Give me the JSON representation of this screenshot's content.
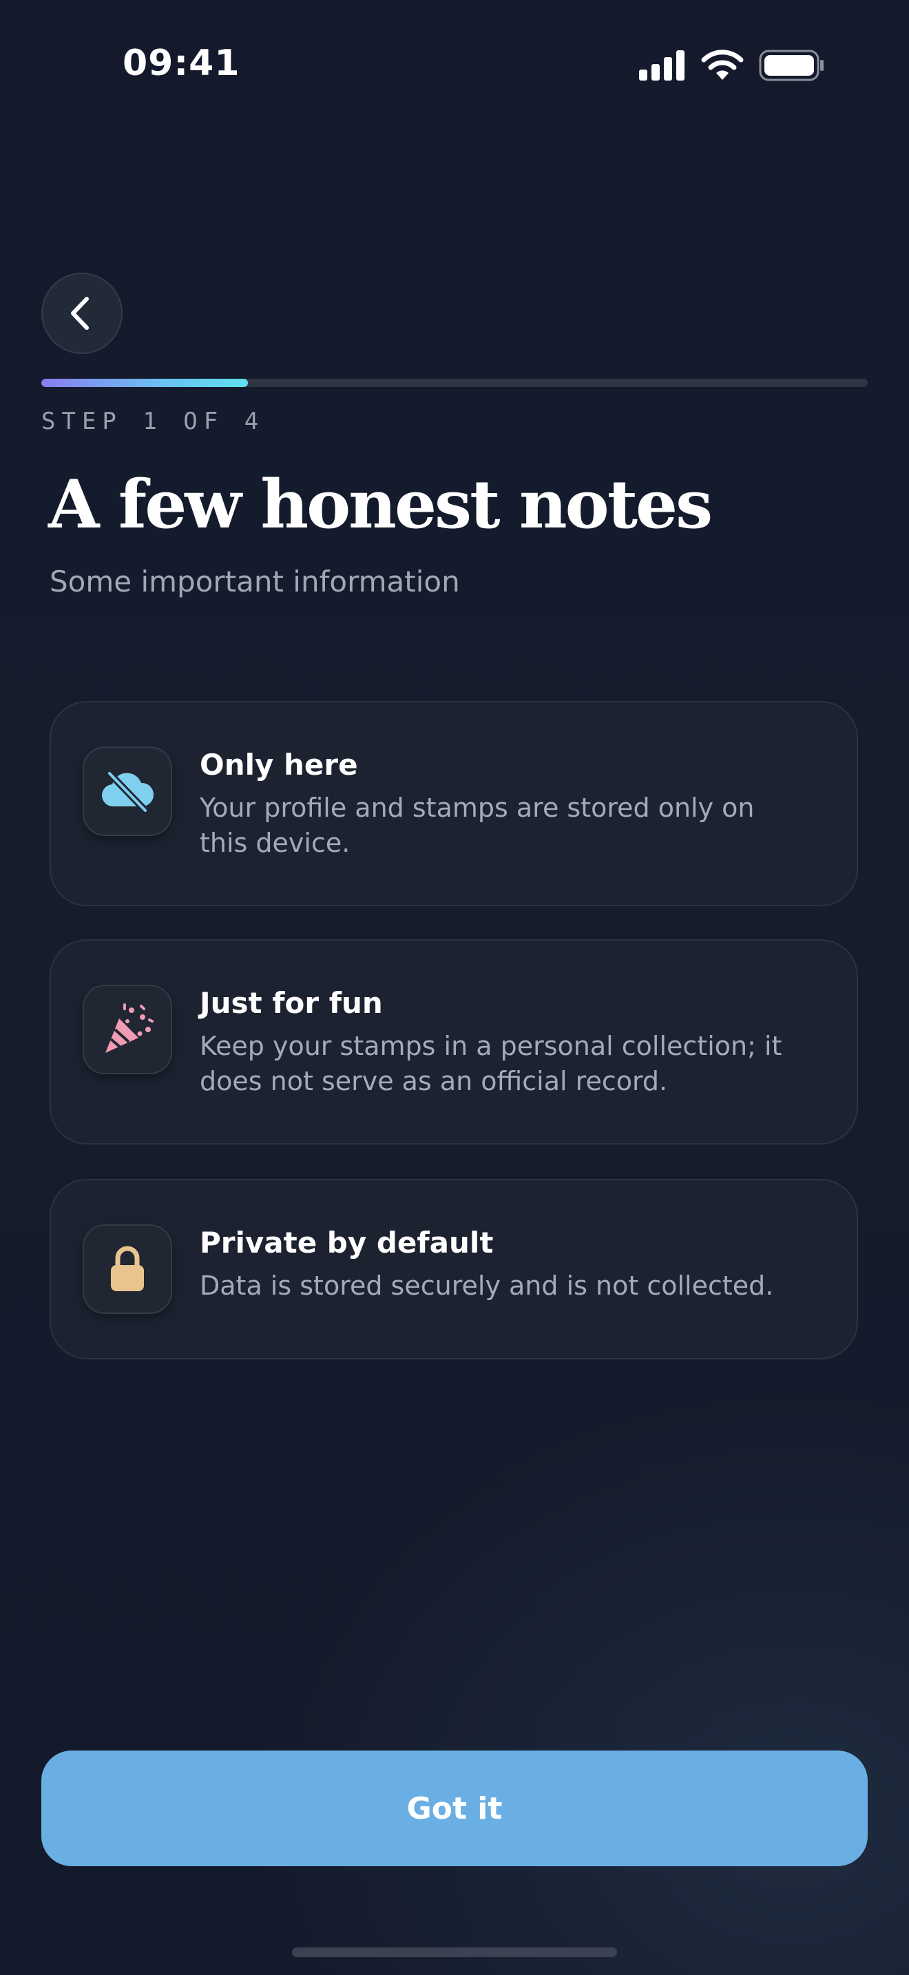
{
  "status_bar": {
    "time": "09:41",
    "icons": [
      "cellular-signal-icon",
      "wifi-icon",
      "battery-icon"
    ]
  },
  "nav": {
    "back_icon": "chevron-left-icon"
  },
  "progress": {
    "value": 0.25,
    "step_label": "STEP 1 OF 4"
  },
  "header": {
    "title": "A few honest notes",
    "subtitle": "Some important information"
  },
  "cards": [
    {
      "icon": "cloud-off-icon",
      "title": "Only here",
      "description": "Your profile and stamps are stored only on this device."
    },
    {
      "icon": "party-popper-icon",
      "title": "Just for fun",
      "description": "Keep your stamps in a personal collection; it does not serve as an official record."
    },
    {
      "icon": "lock-icon",
      "title": "Private by default",
      "description": "Data is stored securely and is not collected."
    }
  ],
  "cta": {
    "label": "Got it"
  },
  "colors": {
    "background": "#141a2c",
    "card": "#1c2230",
    "accent_button": "#6aafe4",
    "progress_start": "#8a7cf0",
    "progress_end": "#5fe0ef",
    "cloud_icon": "#7fd0ef",
    "popper_icon": "#f29bb4",
    "lock_icon": "#e9c48e"
  }
}
